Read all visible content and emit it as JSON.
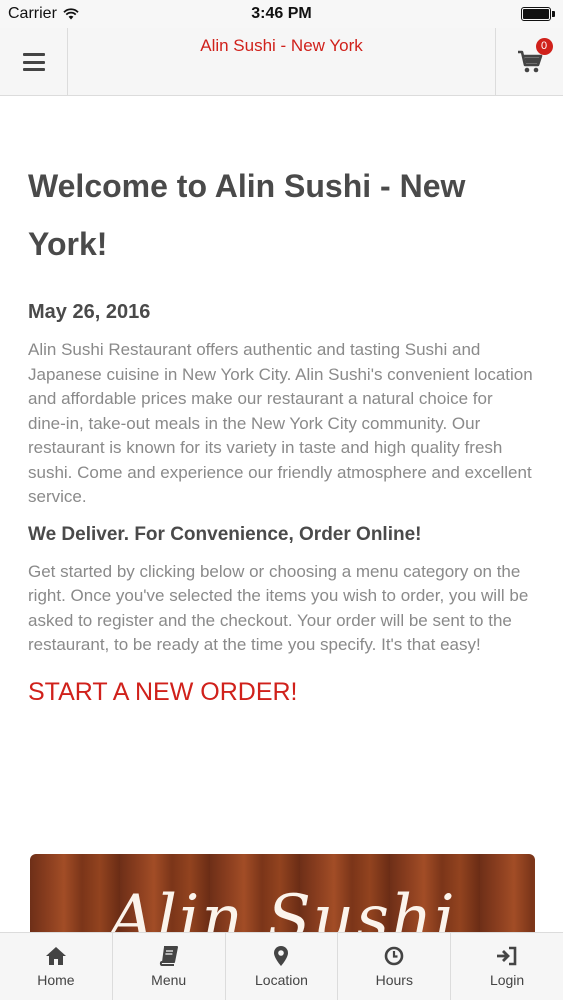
{
  "status_bar": {
    "carrier": "Carrier",
    "time": "3:46 PM"
  },
  "header": {
    "title": "Alin Sushi - New York",
    "cart_count": "0"
  },
  "content": {
    "title": "Welcome to Alin Sushi - New York!",
    "date": "May 26, 2016",
    "intro": "Alin Sushi Restaurant offers authentic and tasting Sushi and Japanese cuisine in New York City. Alin Sushi's convenient location and affordable prices make our restaurant a natural choice for dine-in, take-out meals in the New York City community. Our restaurant is known for its variety in taste and high quality fresh sushi. Come and experience our friendly atmosphere and excellent service.",
    "deliver_heading": "We Deliver. For Convenience, Order Online!",
    "instructions": "Get started by clicking below or choosing a menu category on the right. Once you've selected the items you wish to order, you will be asked to register and the checkout. Your order will be sent to the restaurant, to be ready at the time you specify. It's that easy!",
    "cta": "START A NEW ORDER!"
  },
  "banner": {
    "logo_text": "Alin Sushi"
  },
  "tabs": [
    {
      "label": "Home",
      "icon": "home-icon"
    },
    {
      "label": "Menu",
      "icon": "book-icon"
    },
    {
      "label": "Location",
      "icon": "map-pin-icon"
    },
    {
      "label": "Hours",
      "icon": "clock-icon"
    },
    {
      "label": "Login",
      "icon": "sign-in-icon"
    }
  ],
  "colors": {
    "brand": "#d0211b",
    "text_dark": "#4a4a4a",
    "text_muted": "#8a8a8a",
    "bar_bg": "#f6f6f6"
  }
}
